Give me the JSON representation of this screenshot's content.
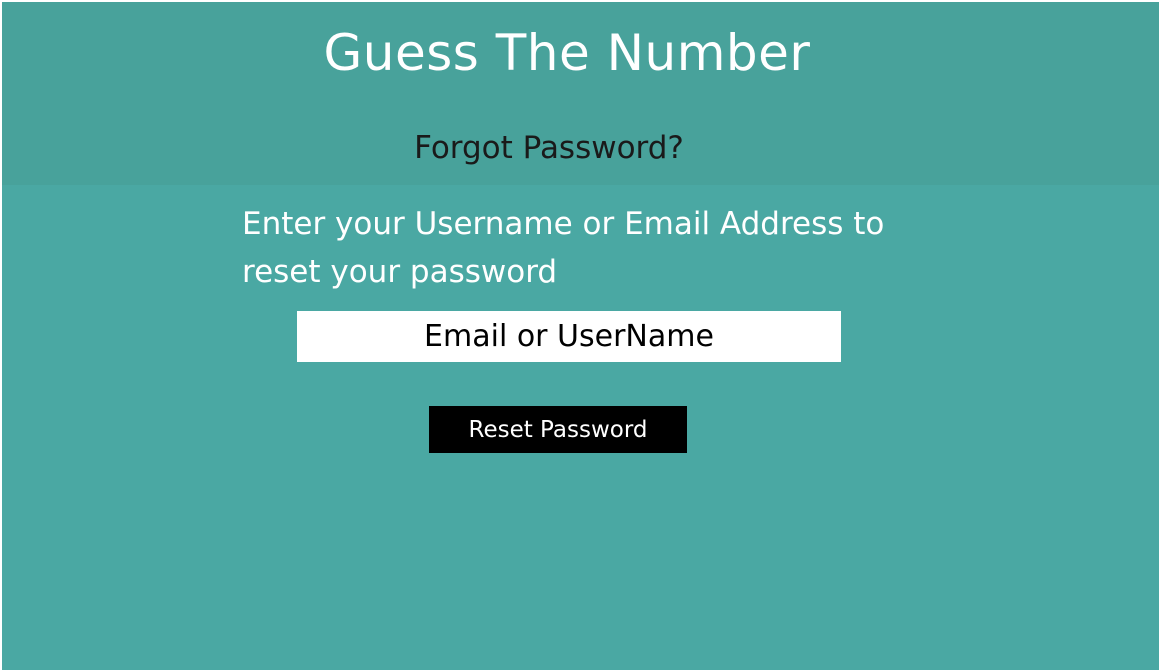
{
  "header": {
    "app_title": "Guess The Number",
    "page_heading": "Forgot Password?"
  },
  "form": {
    "instruction": "Enter your Username or Email Address to reset your password",
    "email_placeholder": "Email or UserName",
    "email_value": "",
    "reset_label": "Reset Password"
  },
  "colors": {
    "background": "#4aa8a3",
    "header_background": "#48a29b",
    "button": "#000000",
    "input": "#ffffff"
  }
}
